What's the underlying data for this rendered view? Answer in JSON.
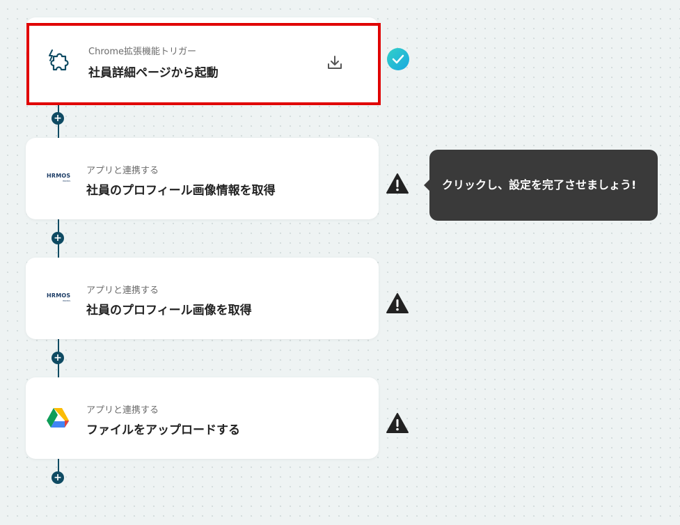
{
  "steps": [
    {
      "subtitle": "Chrome拡張機能トリガー",
      "title": "社員詳細ページから起動",
      "icon": "puzzle-icon",
      "status": "complete",
      "selected": true
    },
    {
      "subtitle": "アプリと連携する",
      "title": "社員のプロフィール画像情報を取得",
      "icon": "hrmos-logo",
      "status": "warning"
    },
    {
      "subtitle": "アプリと連携する",
      "title": "社員のプロフィール画像を取得",
      "icon": "hrmos-logo",
      "status": "warning"
    },
    {
      "subtitle": "アプリと連携する",
      "title": "ファイルをアップロードする",
      "icon": "google-drive-icon",
      "status": "warning"
    }
  ],
  "logos": {
    "hrmos_main": "HRMOS",
    "hrmos_sub": "HRMOS"
  },
  "add_button_label": "+",
  "tooltip": {
    "text": "クリックし、設定を完了させましょう!"
  },
  "colors": {
    "connector": "#0f4b63",
    "highlight_border": "#e00000",
    "check_badge": "#1fb9d4",
    "tooltip_bg": "#3a3a3a"
  }
}
